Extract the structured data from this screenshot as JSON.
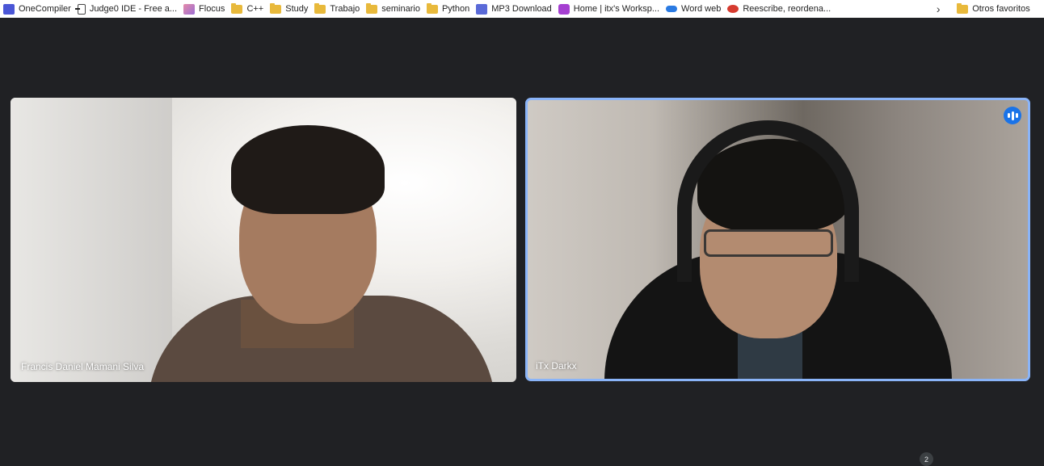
{
  "bookmarks": [
    {
      "label": "OneCompiler",
      "icon": "onecompiler-icon"
    },
    {
      "label": "Judge0 IDE - Free a...",
      "icon": "judge0-icon"
    },
    {
      "label": "Flocus",
      "icon": "flocus-icon"
    },
    {
      "label": "C++",
      "icon": "folder-icon"
    },
    {
      "label": "Study",
      "icon": "folder-icon"
    },
    {
      "label": "Trabajo",
      "icon": "folder-icon"
    },
    {
      "label": "seminario",
      "icon": "folder-icon"
    },
    {
      "label": "Python",
      "icon": "folder-icon"
    },
    {
      "label": "MP3 Download",
      "icon": "mp3-icon"
    },
    {
      "label": "Home | itx's Worksp...",
      "icon": "notion-icon"
    },
    {
      "label": "Word web",
      "icon": "onedrive-icon"
    },
    {
      "label": "Reescribe, reordena...",
      "icon": "reescribe-icon"
    }
  ],
  "more_chevron": "›",
  "other_favorites": "Otros favoritos",
  "participants": [
    {
      "name": "Francis Daniel Mamani Silva",
      "speaking": false
    },
    {
      "name": "iTx Darkx",
      "speaking": true
    }
  ],
  "participant_count": "2",
  "colors": {
    "background": "#202124",
    "active_speaker_border": "#8ab4f8",
    "speaking_indicator": "#1a73e8"
  }
}
